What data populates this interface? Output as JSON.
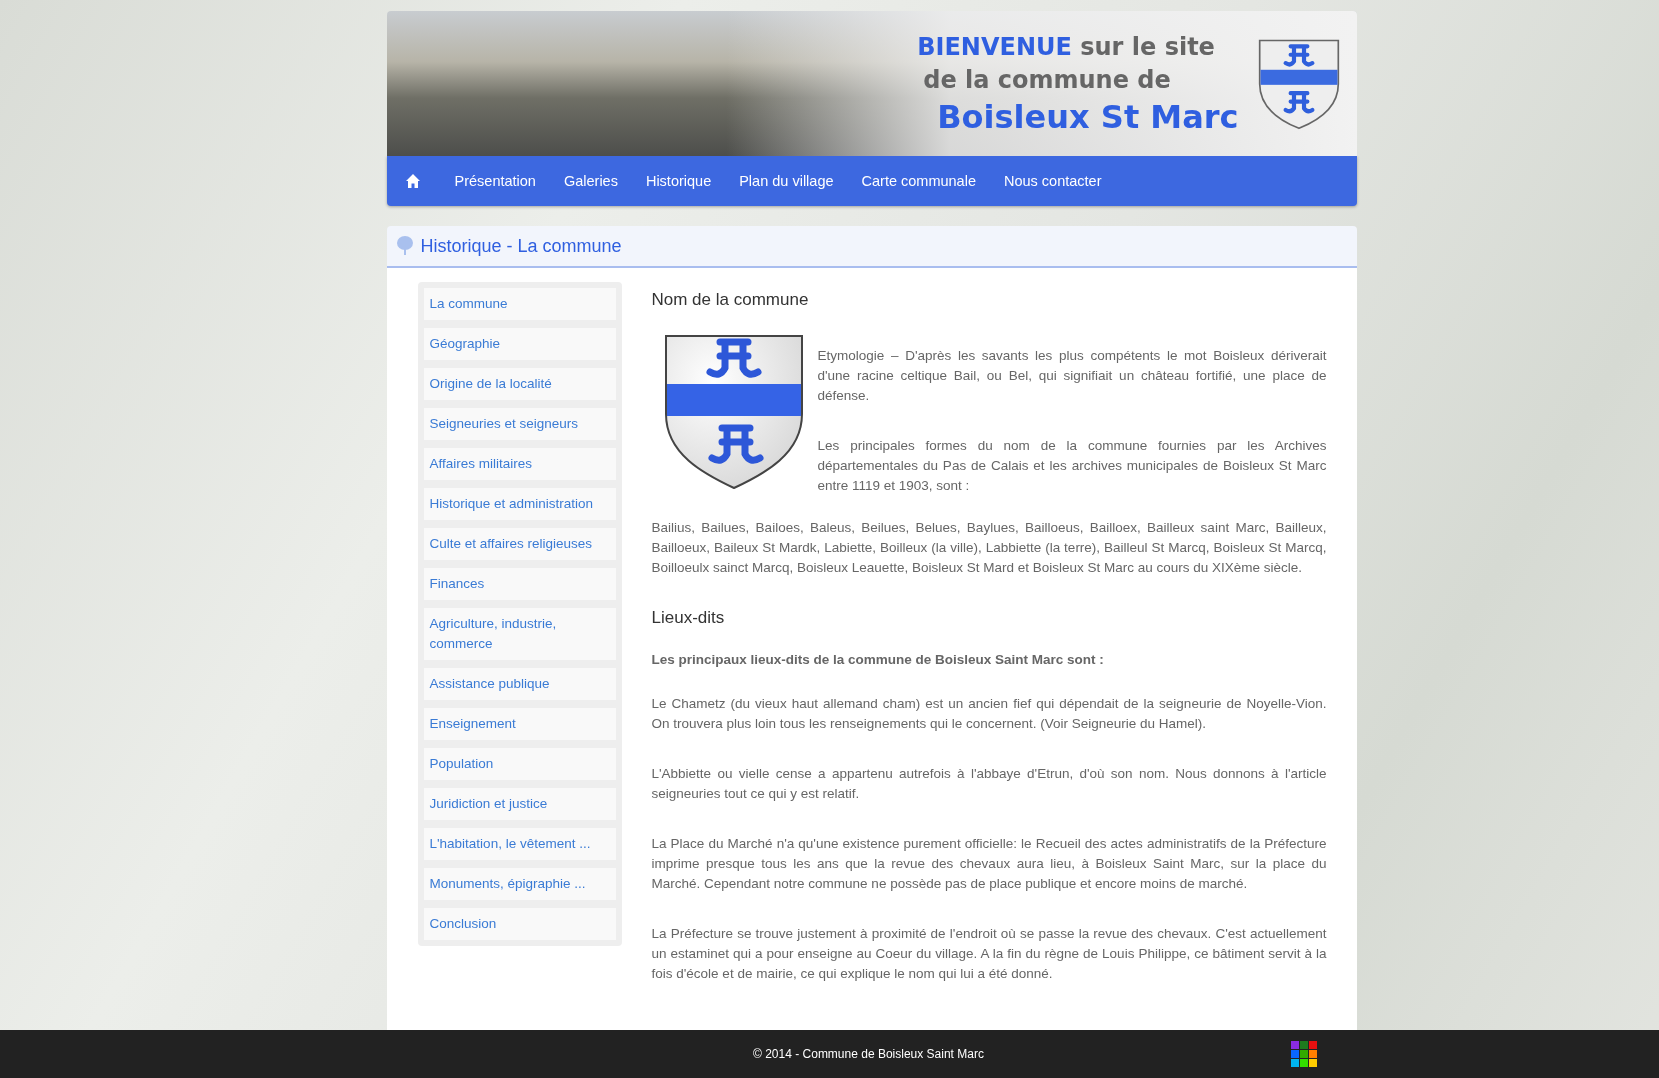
{
  "banner": {
    "welcome": "BIENVENUE",
    "welcome_rest": "sur le site",
    "line2": "de la commune de",
    "town": "Boisleux St Marc"
  },
  "nav": {
    "items": [
      {
        "label": "Présentation",
        "selected": false
      },
      {
        "label": "Galeries",
        "selected": false
      },
      {
        "label": "Historique",
        "selected": false
      },
      {
        "label": "Plan du village",
        "selected": false
      },
      {
        "label": "Carte communale",
        "selected": false
      },
      {
        "label": "Nous contacter",
        "selected": false
      }
    ]
  },
  "page_title": "Historique - La commune",
  "sidebar": {
    "items": [
      {
        "label": "La commune",
        "selected": false
      },
      {
        "label": "Géographie",
        "selected": false
      },
      {
        "label": "Origine de la localité",
        "selected": false
      },
      {
        "label": "Seigneuries et seigneurs",
        "selected": false
      },
      {
        "label": "Affaires militaires",
        "selected": false
      },
      {
        "label": "Historique et administration",
        "selected": false
      },
      {
        "label": "Culte et affaires religieuses",
        "selected": false
      },
      {
        "label": "Finances",
        "selected": false
      },
      {
        "label": "Agriculture, industrie, commerce",
        "selected": false
      },
      {
        "label": "Assistance publique",
        "selected": false
      },
      {
        "label": "Enseignement",
        "selected": false
      },
      {
        "label": "Population",
        "selected": false
      },
      {
        "label": "Juridiction et justice",
        "selected": false
      },
      {
        "label": "L'habitation, le vêtement ...",
        "selected": false
      },
      {
        "label": "Monuments, épigraphie ...",
        "selected": false
      },
      {
        "label": "Conclusion",
        "selected": false
      }
    ]
  },
  "content": {
    "blocks": [
      {
        "kind": "heading",
        "text": "Nom de la commune"
      },
      {
        "kind": "emblem",
        "paragraphs": [
          "Etymologie – D'après les savants les plus compétents le mot Boisleux dériverait d'une racine celtique Bail, ou Bel, qui signifiait un château fortifié, une place de défense.",
          "Les principales formes du nom de la commune fournies par les Archives départementales du Pas de Calais et les archives municipales de Boisleux St Marc entre 1119 et 1903, sont :"
        ]
      },
      {
        "kind": "text",
        "text": "Bailius, Bailues, Bailoes, Baleus, Beilues, Belues, Baylues, Bailloeus, Bailloex, Bailleux saint Marc, Bailleux, Bailloeux, Baileux St Mardk, Labiette, Boilleux (la ville), Labbiette (la terre), Bailleul St Marcq, Boisleux St Marcq, Boilloeulx sainct Marcq, Boisleux Leauette, Boisleux St Mard et Boisleux St Marc au cours du XIXème siècle."
      },
      {
        "kind": "heading",
        "text": "Lieux-dits"
      },
      {
        "kind": "lead",
        "text": "Les principaux lieux-dits de la commune de Boisleux Saint Marc sont :"
      },
      {
        "kind": "text",
        "text": "Le Chametz (du vieux haut allemand cham) est un ancien fief qui dépendait de la seigneurie de Noyelle-Vion. On trouvera plus loin tous les renseignements qui le concernent. (Voir Seigneurie du Hamel)."
      },
      {
        "kind": "text",
        "text": "L'Abbiette ou vielle cense a appartenu autrefois à l'abbaye d'Etrun, d'où son nom. Nous donnons à l'article seigneuries tout ce qui y est relatif."
      },
      {
        "kind": "text",
        "text": "La Place du Marché n'a qu'une existence purement officielle: le Recueil des actes administratifs de la Préfecture imprime presque tous les ans que la revue des chevaux aura lieu, à Boisleux Saint Marc, sur la place du Marché. Cependant notre commune ne possède pas de place publique et encore moins de marché."
      },
      {
        "kind": "text",
        "text": "La Préfecture se trouve justement à proximité de l'endroit où se passe la revue des chevaux. C'est actuellement un estaminet qui a pour enseigne au Coeur du village. A la fin du règne de Louis Philippe, ce bâtiment servit à la fois d'école et de mairie, ce qui explique le nom qui lui a été donné."
      }
    ]
  },
  "footer": {
    "copyright": "© 2014 - Commune de Boisleux Saint Marc"
  }
}
